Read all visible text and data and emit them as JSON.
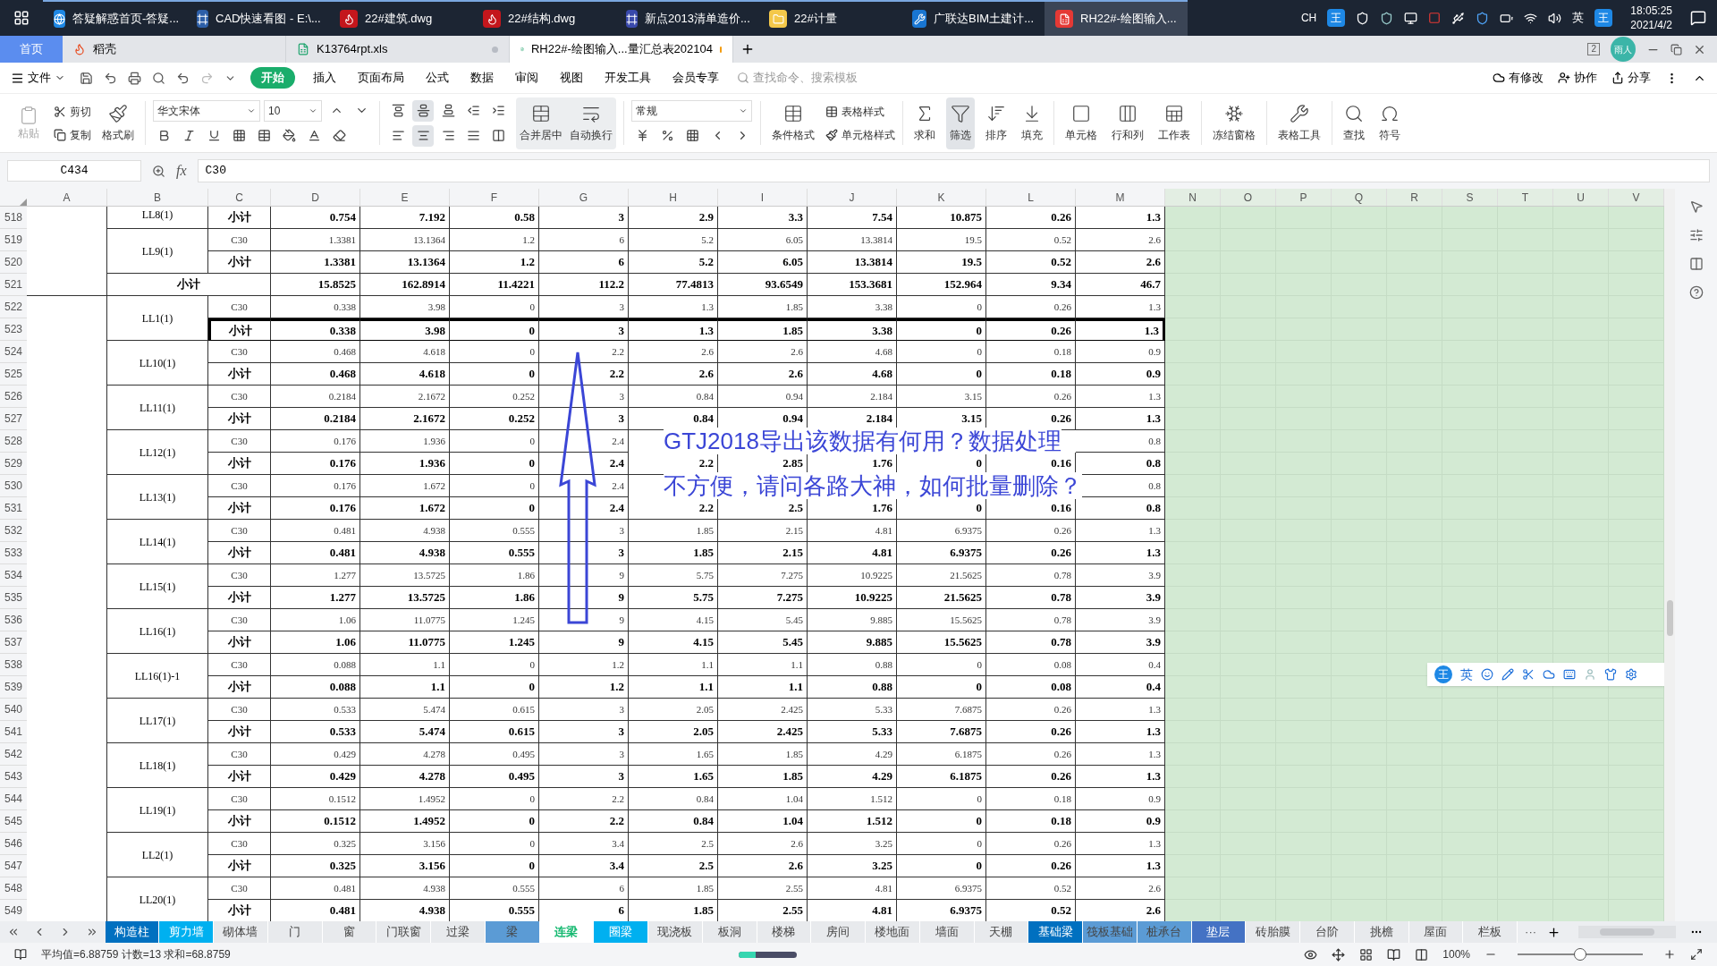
{
  "taskbar": {
    "apps": [
      {
        "kind": "browser",
        "title": "答疑解惑首页-答疑...",
        "selected": false
      },
      {
        "kind": "cad",
        "title": "CAD快速看图 - E:\\...",
        "selected": false
      },
      {
        "kind": "autocad",
        "title": "22#建筑.dwg",
        "selected": false
      },
      {
        "kind": "autocad",
        "title": "22#结构.dwg",
        "selected": false
      },
      {
        "kind": "xindian",
        "title": "新点2013清单造价...",
        "selected": false
      },
      {
        "kind": "folder",
        "title": "22#计量",
        "selected": false
      },
      {
        "kind": "glodon",
        "title": "广联达BIM土建计...",
        "selected": false
      },
      {
        "kind": "wps",
        "title": "RH22#-绘图输入...",
        "selected": true
      }
    ],
    "tray_lang": "CH",
    "tray_logo": "王",
    "tray_ime": "英",
    "tray_logo_right": "王",
    "time": "18:05:25",
    "date": "2021/4/2"
  },
  "doc_tabs": [
    {
      "kind": "home",
      "label": "首页",
      "selected": false
    },
    {
      "kind": "docer",
      "label": "稻壳",
      "selected": false
    },
    {
      "kind": "sheet",
      "label": "K13764rpt.xls",
      "selected": false,
      "modified": false
    },
    {
      "kind": "sheet",
      "label": "RH22#-绘图输入...量汇总表202104",
      "selected": true,
      "modified": true
    }
  ],
  "window": {
    "badge": "2",
    "avatar": "雨人"
  },
  "menu": {
    "file": "文件",
    "tabs": [
      {
        "label": "开始",
        "selected": true
      },
      {
        "label": "插入",
        "selected": false
      },
      {
        "label": "页面布局",
        "selected": false
      },
      {
        "label": "公式",
        "selected": false
      },
      {
        "label": "数据",
        "selected": false
      },
      {
        "label": "审阅",
        "selected": false
      },
      {
        "label": "视图",
        "selected": false
      },
      {
        "label": "开发工具",
        "selected": false
      },
      {
        "label": "会员专享",
        "selected": false
      }
    ],
    "search_placeholder": "查找命令、搜索模板",
    "actions": [
      "有修改",
      "协作",
      "分享"
    ]
  },
  "ribbon": {
    "paste": "粘贴",
    "cut": "剪切",
    "copy": "复制",
    "format_painter": "格式刷",
    "font_name": "华文宋体",
    "font_size": "10",
    "merge": "合并居中",
    "wrap": "自动换行",
    "number_format": "常规",
    "conditional": "条件格式",
    "table_style": "表格样式",
    "cell_style": "单元格样式",
    "tools": [
      {
        "label": "求和",
        "selected": false
      },
      {
        "label": "筛选",
        "selected": true
      },
      {
        "label": "排序",
        "selected": false
      },
      {
        "label": "填充",
        "selected": false
      },
      {
        "label": "单元格",
        "selected": false
      },
      {
        "label": "行和列",
        "selected": false
      },
      {
        "label": "工作表",
        "selected": false
      },
      {
        "label": "冻结窗格",
        "selected": false
      },
      {
        "label": "表格工具",
        "selected": false
      },
      {
        "label": "查找",
        "selected": false
      },
      {
        "label": "符号",
        "selected": false
      }
    ]
  },
  "formula_bar": {
    "cell": "C434",
    "function_label": "fx",
    "value": "C30"
  },
  "columns": [
    "A",
    "B",
    "C",
    "D",
    "E",
    "F",
    "G",
    "H",
    "I",
    "J",
    "K",
    "L",
    "M",
    "N",
    "O",
    "P",
    "Q",
    "R",
    "S",
    "T",
    "U",
    "V"
  ],
  "groups": [
    {
      "kind": "member",
      "member": "LL8(1)",
      "rows": [
        {
          "row": "518",
          "grade": "小计",
          "selected": false,
          "values": [
            "0.754",
            "7.192",
            "0.58",
            "3",
            "2.9",
            "3.3",
            "7.54",
            "10.875",
            "0.26",
            "1.3"
          ]
        }
      ]
    },
    {
      "kind": "member",
      "member": "LL9(1)",
      "rows": [
        {
          "row": "519",
          "grade": "C30",
          "selected": false,
          "values": [
            "1.3381",
            "13.1364",
            "1.2",
            "6",
            "5.2",
            "6.05",
            "13.3814",
            "19.5",
            "0.52",
            "2.6"
          ]
        },
        {
          "row": "520",
          "grade": "小计",
          "selected": false,
          "values": [
            "1.3381",
            "13.1364",
            "1.2",
            "6",
            "5.2",
            "6.05",
            "13.3814",
            "19.5",
            "0.52",
            "2.6"
          ]
        }
      ]
    },
    {
      "kind": "total",
      "member": "小计",
      "rows": [
        {
          "row": "521",
          "selected": false,
          "values": [
            "15.8525",
            "162.8914",
            "11.4221",
            "112.2",
            "77.4813",
            "93.6549",
            "153.3681",
            "152.964",
            "9.34",
            "46.7"
          ]
        }
      ]
    },
    {
      "kind": "member",
      "member": "LL1(1)",
      "rows": [
        {
          "row": "522",
          "grade": "C30",
          "selected": false,
          "values": [
            "0.338",
            "3.98",
            "0",
            "3",
            "1.3",
            "1.85",
            "3.38",
            "0",
            "0.26",
            "1.3"
          ]
        },
        {
          "row": "523",
          "grade": "小计",
          "selected": true,
          "values": [
            "0.338",
            "3.98",
            "0",
            "3",
            "1.3",
            "1.85",
            "3.38",
            "0",
            "0.26",
            "1.3"
          ]
        }
      ]
    },
    {
      "kind": "member",
      "member": "LL10(1)",
      "rows": [
        {
          "row": "524",
          "grade": "C30",
          "selected": false,
          "values": [
            "0.468",
            "4.618",
            "0",
            "2.2",
            "2.6",
            "2.6",
            "4.68",
            "0",
            "0.18",
            "0.9"
          ]
        },
        {
          "row": "525",
          "grade": "小计",
          "selected": false,
          "values": [
            "0.468",
            "4.618",
            "0",
            "2.2",
            "2.6",
            "2.6",
            "4.68",
            "0",
            "0.18",
            "0.9"
          ]
        }
      ]
    },
    {
      "kind": "member",
      "member": "LL11(1)",
      "rows": [
        {
          "row": "526",
          "grade": "C30",
          "selected": false,
          "values": [
            "0.2184",
            "2.1672",
            "0.252",
            "3",
            "0.84",
            "0.94",
            "2.184",
            "3.15",
            "0.26",
            "1.3"
          ]
        },
        {
          "row": "527",
          "grade": "小计",
          "selected": false,
          "values": [
            "0.2184",
            "2.1672",
            "0.252",
            "3",
            "0.84",
            "0.94",
            "2.184",
            "3.15",
            "0.26",
            "1.3"
          ]
        }
      ]
    },
    {
      "kind": "member",
      "member": "LL12(1)",
      "rows": [
        {
          "row": "528",
          "grade": "C30",
          "selected": false,
          "cells": {
            "D": "0.176",
            "E": "1.936",
            "F": "0",
            "G": "2.4",
            "M": "0.8"
          }
        },
        {
          "row": "529",
          "grade": "小计",
          "selected": false,
          "values": [
            "0.176",
            "1.936",
            "0",
            "2.4",
            "2.2",
            "2.85",
            "1.76",
            "0",
            "0.16",
            "0.8"
          ]
        }
      ]
    },
    {
      "kind": "member",
      "member": "LL13(1)",
      "rows": [
        {
          "row": "530",
          "grade": "C30",
          "selected": false,
          "cells": {
            "D": "0.176",
            "E": "1.672",
            "F": "0",
            "G": "2.4",
            "M": "0.8"
          }
        },
        {
          "row": "531",
          "grade": "小计",
          "selected": false,
          "values": [
            "0.176",
            "1.672",
            "0",
            "2.4",
            "2.2",
            "2.5",
            "1.76",
            "0",
            "0.16",
            "0.8"
          ]
        }
      ]
    },
    {
      "kind": "member",
      "member": "LL14(1)",
      "rows": [
        {
          "row": "532",
          "grade": "C30",
          "selected": false,
          "values": [
            "0.481",
            "4.938",
            "0.555",
            "3",
            "1.85",
            "2.15",
            "4.81",
            "6.9375",
            "0.26",
            "1.3"
          ]
        },
        {
          "row": "533",
          "grade": "小计",
          "selected": false,
          "values": [
            "0.481",
            "4.938",
            "0.555",
            "3",
            "1.85",
            "2.15",
            "4.81",
            "6.9375",
            "0.26",
            "1.3"
          ]
        }
      ]
    },
    {
      "kind": "member",
      "member": "LL15(1)",
      "rows": [
        {
          "row": "534",
          "grade": "C30",
          "selected": false,
          "values": [
            "1.277",
            "13.5725",
            "1.86",
            "9",
            "5.75",
            "7.275",
            "10.9225",
            "21.5625",
            "0.78",
            "3.9"
          ]
        },
        {
          "row": "535",
          "grade": "小计",
          "selected": false,
          "values": [
            "1.277",
            "13.5725",
            "1.86",
            "9",
            "5.75",
            "7.275",
            "10.9225",
            "21.5625",
            "0.78",
            "3.9"
          ]
        }
      ]
    },
    {
      "kind": "member",
      "member": "LL16(1)",
      "rows": [
        {
          "row": "536",
          "grade": "C30",
          "selected": false,
          "values": [
            "1.06",
            "11.0775",
            "1.245",
            "9",
            "4.15",
            "5.45",
            "9.885",
            "15.5625",
            "0.78",
            "3.9"
          ]
        },
        {
          "row": "537",
          "grade": "小计",
          "selected": false,
          "values": [
            "1.06",
            "11.0775",
            "1.245",
            "9",
            "4.15",
            "5.45",
            "9.885",
            "15.5625",
            "0.78",
            "3.9"
          ]
        }
      ]
    },
    {
      "kind": "member",
      "member": "LL16(1)-1",
      "rows": [
        {
          "row": "538",
          "grade": "C30",
          "selected": false,
          "values": [
            "0.088",
            "1.1",
            "0",
            "1.2",
            "1.1",
            "1.1",
            "0.88",
            "0",
            "0.08",
            "0.4"
          ]
        },
        {
          "row": "539",
          "grade": "小计",
          "selected": false,
          "values": [
            "0.088",
            "1.1",
            "0",
            "1.2",
            "1.1",
            "1.1",
            "0.88",
            "0",
            "0.08",
            "0.4"
          ]
        }
      ]
    },
    {
      "kind": "member",
      "member": "LL17(1)",
      "rows": [
        {
          "row": "540",
          "grade": "C30",
          "selected": false,
          "values": [
            "0.533",
            "5.474",
            "0.615",
            "3",
            "2.05",
            "2.425",
            "5.33",
            "7.6875",
            "0.26",
            "1.3"
          ]
        },
        {
          "row": "541",
          "grade": "小计",
          "selected": false,
          "values": [
            "0.533",
            "5.474",
            "0.615",
            "3",
            "2.05",
            "2.425",
            "5.33",
            "7.6875",
            "0.26",
            "1.3"
          ]
        }
      ]
    },
    {
      "kind": "member",
      "member": "LL18(1)",
      "rows": [
        {
          "row": "542",
          "grade": "C30",
          "selected": false,
          "values": [
            "0.429",
            "4.278",
            "0.495",
            "3",
            "1.65",
            "1.85",
            "4.29",
            "6.1875",
            "0.26",
            "1.3"
          ]
        },
        {
          "row": "543",
          "grade": "小计",
          "selected": false,
          "values": [
            "0.429",
            "4.278",
            "0.495",
            "3",
            "1.65",
            "1.85",
            "4.29",
            "6.1875",
            "0.26",
            "1.3"
          ]
        }
      ]
    },
    {
      "kind": "member",
      "member": "LL19(1)",
      "rows": [
        {
          "row": "544",
          "grade": "C30",
          "selected": false,
          "values": [
            "0.1512",
            "1.4952",
            "0",
            "2.2",
            "0.84",
            "1.04",
            "1.512",
            "0",
            "0.18",
            "0.9"
          ]
        },
        {
          "row": "545",
          "grade": "小计",
          "selected": false,
          "values": [
            "0.1512",
            "1.4952",
            "0",
            "2.2",
            "0.84",
            "1.04",
            "1.512",
            "0",
            "0.18",
            "0.9"
          ]
        }
      ]
    },
    {
      "kind": "member",
      "member": "LL2(1)",
      "rows": [
        {
          "row": "546",
          "grade": "C30",
          "selected": false,
          "values": [
            "0.325",
            "3.156",
            "0",
            "3.4",
            "2.5",
            "2.6",
            "3.25",
            "0",
            "0.26",
            "1.3"
          ]
        },
        {
          "row": "547",
          "grade": "小计",
          "selected": false,
          "values": [
            "0.325",
            "3.156",
            "0",
            "3.4",
            "2.5",
            "2.6",
            "3.25",
            "0",
            "0.26",
            "1.3"
          ]
        }
      ]
    },
    {
      "kind": "member",
      "member": "LL20(1)",
      "rows": [
        {
          "row": "548",
          "grade": "C30",
          "selected": false,
          "values": [
            "0.481",
            "4.938",
            "0.555",
            "6",
            "1.85",
            "2.55",
            "4.81",
            "6.9375",
            "0.52",
            "2.6"
          ]
        },
        {
          "row": "549",
          "grade": "小计",
          "selected": false,
          "values": [
            "0.481",
            "4.938",
            "0.555",
            "6",
            "1.85",
            "2.55",
            "4.81",
            "6.9375",
            "0.52",
            "2.6"
          ]
        }
      ]
    }
  ],
  "annotation": {
    "text": "GTJ2018导出该数据有何用？数据处理不方便，请问各路大神，如何批量删除？"
  },
  "ime_toolbar": {
    "logo": "王",
    "mode": "英"
  },
  "sheet_tabs": [
    {
      "label": "构造柱",
      "color": "#0070c0",
      "selected": false
    },
    {
      "label": "剪力墙",
      "color": "#00b0f0",
      "selected": false
    },
    {
      "label": "砌体墙",
      "color": "#e8eaed",
      "selected": false
    },
    {
      "label": "门",
      "color": "#e8eaed",
      "selected": false
    },
    {
      "label": "窗",
      "color": "#e8eaed",
      "selected": false
    },
    {
      "label": "门联窗",
      "color": "#e8eaed",
      "selected": false
    },
    {
      "label": "过梁",
      "color": "#e8eaed",
      "selected": false
    },
    {
      "label": "梁",
      "color": "#5b9bd5",
      "selected": false
    },
    {
      "label": "连梁",
      "color": "#ffffff",
      "selected": true
    },
    {
      "label": "圈梁",
      "color": "#00b0f0",
      "selected": false
    },
    {
      "label": "现浇板",
      "color": "#e8eaed",
      "selected": false
    },
    {
      "label": "板洞",
      "color": "#e8eaed",
      "selected": false
    },
    {
      "label": "楼梯",
      "color": "#e8eaed",
      "selected": false
    },
    {
      "label": "房间",
      "color": "#e8eaed",
      "selected": false
    },
    {
      "label": "楼地面",
      "color": "#e8eaed",
      "selected": false
    },
    {
      "label": "墙面",
      "color": "#e8eaed",
      "selected": false
    },
    {
      "label": "天棚",
      "color": "#e8eaed",
      "selected": false
    },
    {
      "label": "基础梁",
      "color": "#0070c0",
      "selected": false
    },
    {
      "label": "筏板基础",
      "color": "#5b9bd5",
      "selected": false
    },
    {
      "label": "桩承台",
      "color": "#5b9bd5",
      "selected": false
    },
    {
      "label": "垫层",
      "color": "#4472c4",
      "selected": false
    },
    {
      "label": "砖胎膜",
      "color": "#e8eaed",
      "selected": false
    },
    {
      "label": "台阶",
      "color": "#e8eaed",
      "selected": false
    },
    {
      "label": "挑檐",
      "color": "#e8eaed",
      "selected": false
    },
    {
      "label": "屋面",
      "color": "#e8eaed",
      "selected": false
    },
    {
      "label": "栏板",
      "color": "#e8eaed",
      "selected": false
    }
  ],
  "sheet_more": "···",
  "status": {
    "summary": "平均值=6.88759 计数=13 求和=68.8759",
    "progress": {
      "level": 0.3
    },
    "zoom": "100%",
    "zoom_slider": {
      "level": 0.5
    }
  }
}
